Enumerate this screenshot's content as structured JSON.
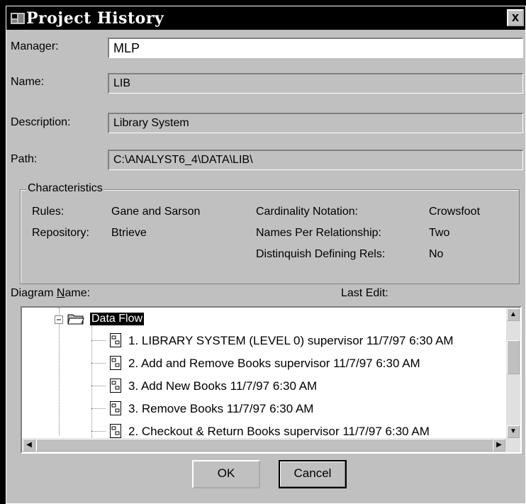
{
  "window": {
    "title": "Project History",
    "close_label": "x"
  },
  "fields": {
    "manager_label": "Manager:",
    "manager_value": "MLP",
    "name_label": "Name:",
    "name_value": "LIB",
    "description_label": "Description:",
    "description_value": "Library System",
    "path_label": "Path:",
    "path_value": "C:\\ANALYST6_4\\DATA\\LIB\\"
  },
  "characteristics": {
    "legend": "Characteristics",
    "rules_label": "Rules:",
    "rules_value": "Gane and Sarson",
    "repository_label": "Repository:",
    "repository_value": "Btrieve",
    "cardinality_label": "Cardinality Notation:",
    "cardinality_value": "Crowsfoot",
    "names_per_rel_label": "Names Per Relationship:",
    "names_per_rel_value": "Two",
    "distinguish_label": "Distinquish Defining Rels:",
    "distinguish_value": "No"
  },
  "diagram_list": {
    "name_header_prefix": "Diagram ",
    "name_header_underlined": "N",
    "name_header_suffix": "ame:",
    "last_edit_header": "Last Edit:",
    "folder": "Data Flow",
    "items": [
      "1. LIBRARY SYSTEM (LEVEL 0)  supervisor  11/7/97 6:30 AM",
      "2. Add and Remove Books  supervisor  11/7/97 6:30 AM",
      "3. Add New Books    11/7/97 6:30 AM",
      "3. Remove Books    11/7/97 6:30 AM",
      "2. Checkout & Return Books  supervisor  11/7/97 6:30 AM"
    ]
  },
  "buttons": {
    "ok": "OK",
    "cancel": "Cancel"
  }
}
